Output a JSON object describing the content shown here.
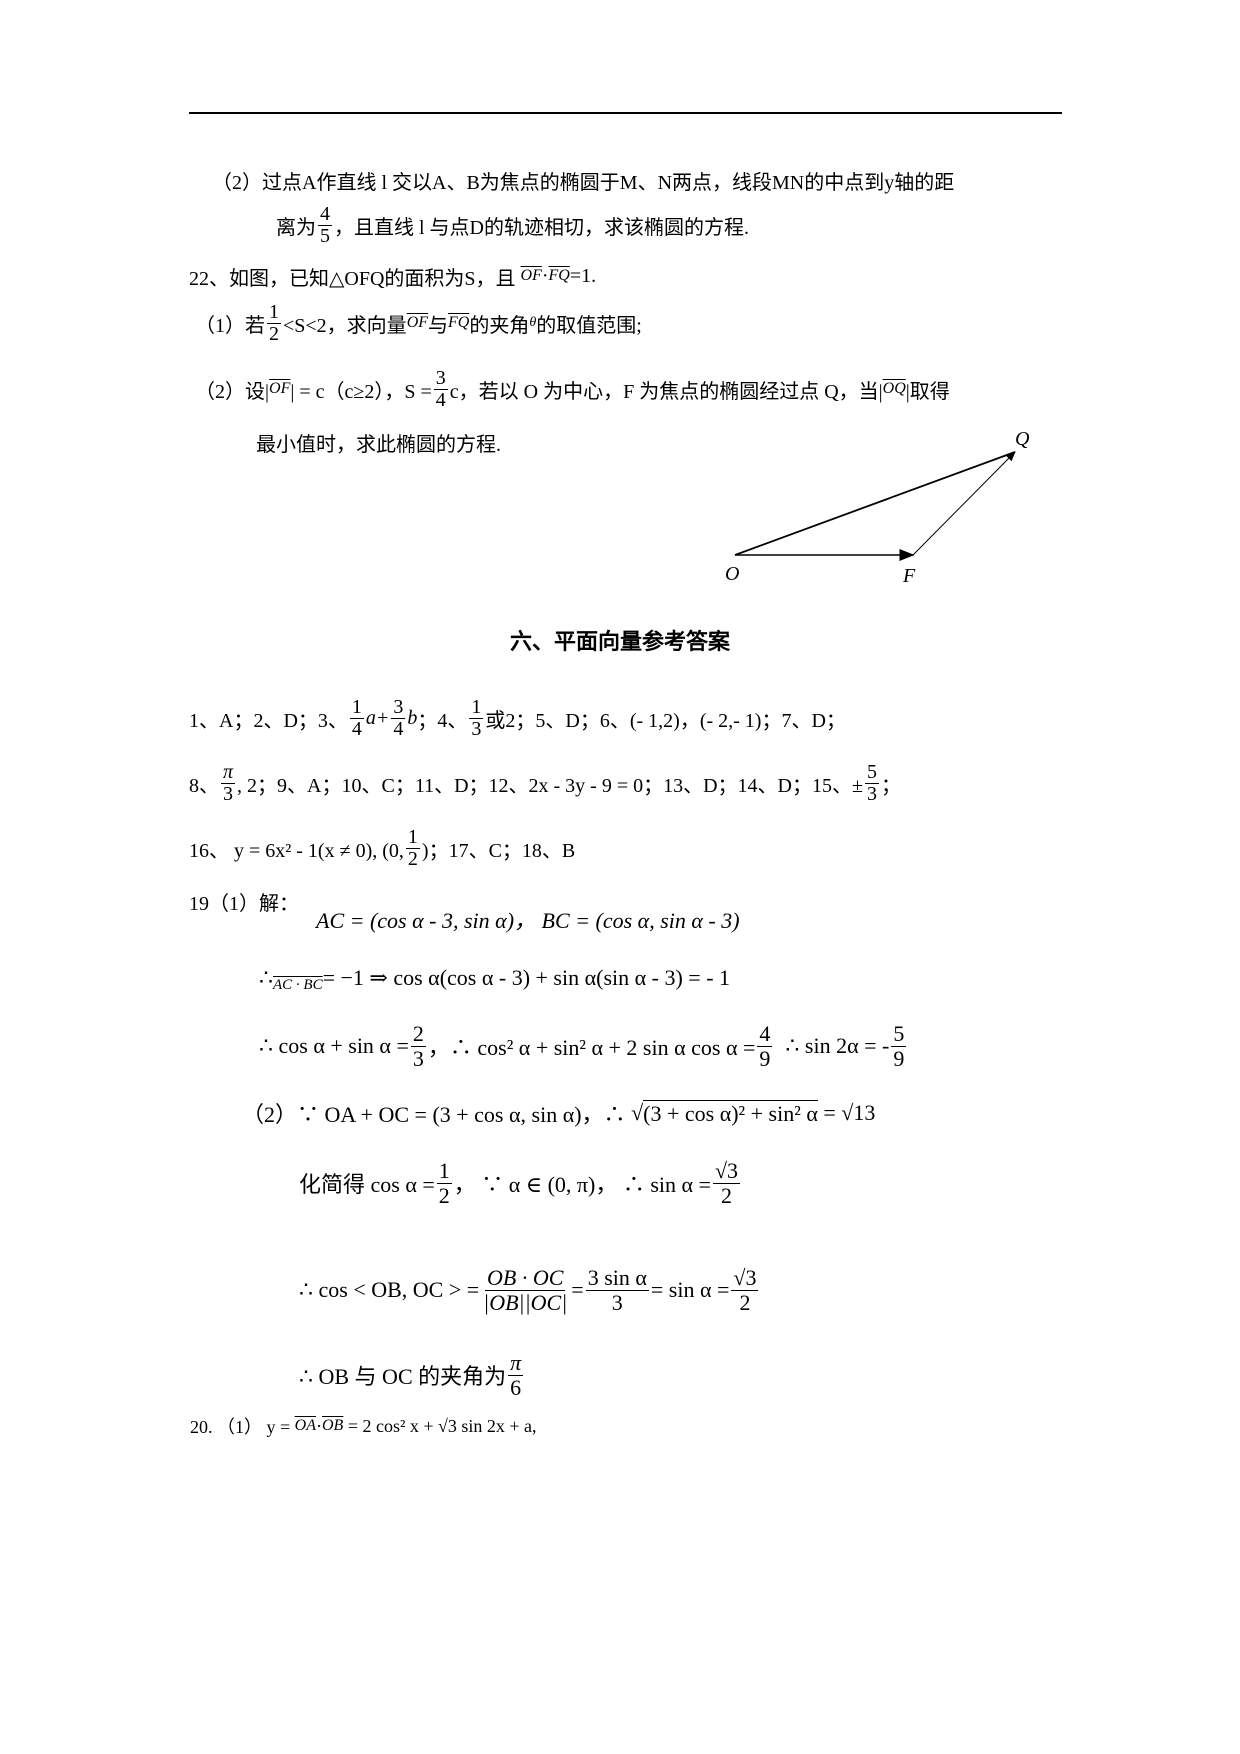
{
  "q21_2": {
    "line1": "（2）过点A作直线 l 交以A、B为焦点的椭圆于M、N两点，线段MN的中点到y轴的距",
    "line2_a": "离为",
    "line2_num": "4",
    "line2_den": "5",
    "line2_b": "，且直线 l 与点D的轨迹相切，求该椭圆的方程."
  },
  "q22": {
    "stem_a": "22、如图，已知△OFQ的面积为S，且",
    "stem_v1": "OF",
    "stem_dot": "·",
    "stem_v2": "FQ",
    "stem_b": "=1.",
    "p1_a": "（1）若",
    "p1_num": "1",
    "p1_den": "2",
    "p1_b": "<S<2，求向量",
    "p1_v1": "OF",
    "p1_c": "与",
    "p1_v2": "FQ",
    "p1_d": "的夹角",
    "p1_theta": "θ",
    "p1_e": "的取值范围;",
    "p2_a": "（2）设|",
    "p2_v1": "OF",
    "p2_b": "| = c（c≥2），S =",
    "p2_num": "3",
    "p2_den": "4",
    "p2_c": "c，若以 O 为中心，F 为焦点的椭圆经过点 Q，当|",
    "p2_v2": "OQ",
    "p2_d": "|取得",
    "p2_line2": "最小值时，求此椭圆的方程."
  },
  "figure": {
    "label_o": "O",
    "label_f": "F",
    "label_q": "Q"
  },
  "answers": {
    "heading": "六、平面向量参考答案",
    "l1_a": "1、A；2、D；3、",
    "l1_f1n": "1",
    "l1_f1d": "4",
    "l1_a2": "a+",
    "l1_f2n": "3",
    "l1_f2d": "4",
    "l1_b2": "b",
    "l1_b": "；4、",
    "l1_f3n": "1",
    "l1_f3d": "3",
    "l1_c": "或2；5、D；6、(- 1,2)，(- 2,- 1)；7、D；",
    "l2_a": "8、",
    "l2_f1n": "π",
    "l2_f1d": "3",
    "l2_b": ", 2；9、A；10、C；11、D；12、2x - 3y - 9 = 0；13、D；14、D；15、±",
    "l2_f2n": "5",
    "l2_f2d": "3",
    "l2_c": "；",
    "l3_a": "16、 y = 6x² - 1(x ≠ 0), (0,",
    "l3_fn": "1",
    "l3_fd": "2",
    "l3_b": ")；17、C；18、B",
    "q19_label": "19（1）解：",
    "q19_l1": "AC = (cos α - 3, sin α)，  BC = (cos α, sin α - 3)",
    "q19_l2_a": "∴",
    "q19_l2_v": "AC · BC",
    "q19_l2_b": "= −1 ⇒  cos α(cos α - 3) + sin α(sin α - 3) = - 1",
    "q19_l3_a": "∴ cos α + sin α =",
    "q19_l3_f1n": "2",
    "q19_l3_f1d": "3",
    "q19_l3_b": "，∴ cos² α + sin² α + 2 sin α cos α =",
    "q19_l3_f2n": "4",
    "q19_l3_f2d": "9",
    "q19_l3_c": "∴ sin 2α = -",
    "q19_l3_f3n": "5",
    "q19_l3_f3d": "9",
    "q19_p2_a": "（2）∵ OA + OC = (3 + cos α, sin α)，∴",
    "q19_p2_sqrt": "(3 + cos α)² + sin² α",
    "q19_p2_b": "= √13",
    "q19_l5_a": "化简得 cos α =",
    "q19_l5_fn": "1",
    "q19_l5_fd": "2",
    "q19_l5_b": "，   ∵ α ∈ (0, π)，  ∴ sin α =",
    "q19_l5_f2n": "√3",
    "q19_l5_f2d": "2",
    "q19_l6_a": "∴ cos < OB, OC > =",
    "q19_l6_f1n": "OB · OC",
    "q19_l6_f1d": "|OB||OC|",
    "q19_l6_b": "=",
    "q19_l6_f2n": "3 sin α",
    "q19_l6_f2d": "3",
    "q19_l6_c": "= sin α =",
    "q19_l6_f3n": "√3",
    "q19_l6_f3d": "2",
    "q19_l7_a": "∴ OB 与 OC 的夹角为",
    "q19_l7_fn": "π",
    "q19_l7_fd": "6",
    "q20_a": "20. （1） y =",
    "q20_v1": "OA",
    "q20_dot": "·",
    "q20_v2": "OB",
    "q20_b": "= 2 cos² x + √3 sin 2x + a,"
  }
}
